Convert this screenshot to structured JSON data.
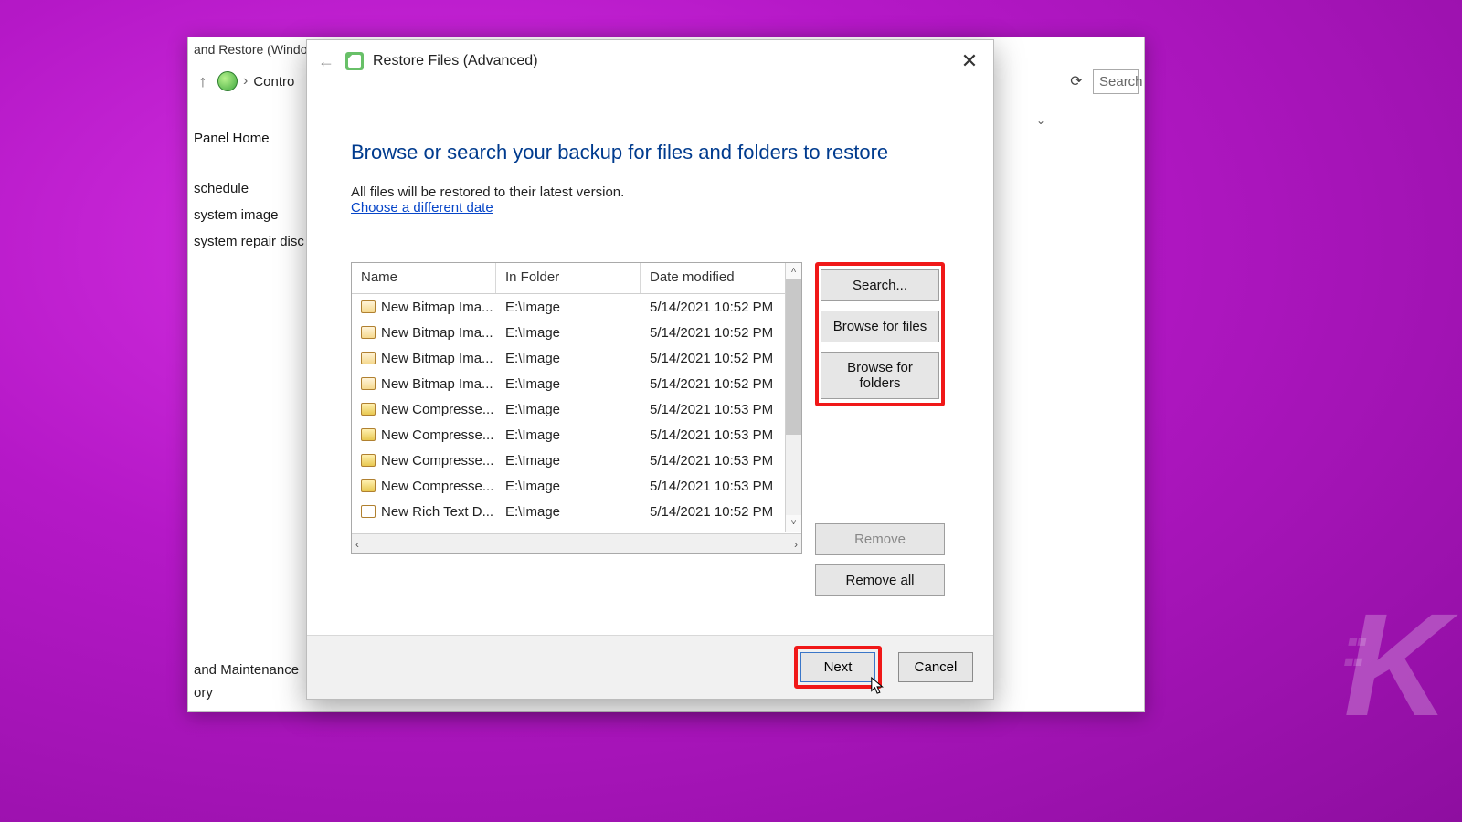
{
  "background_window": {
    "title_fragment": "and Restore (Window...",
    "breadcrumb_start": "Contro",
    "search_placeholder": "Search",
    "sidebar": {
      "home": "Panel Home",
      "items": [
        "schedule",
        "system image",
        "system repair disc"
      ],
      "lower": [
        "and Maintenance",
        "ory"
      ]
    }
  },
  "dialog": {
    "title": "Restore Files (Advanced)",
    "close_symbol": "✕",
    "heading": "Browse or search your backup for files and folders to restore",
    "subtext": "All files will be restored to their latest version.",
    "link_text": "Choose a different date",
    "columns": {
      "name": "Name",
      "folder": "In Folder",
      "date": "Date modified"
    },
    "rows": [
      {
        "icon": "bmp",
        "name": "New Bitmap Ima...",
        "folder": "E:\\Image",
        "date": "5/14/2021 10:52 PM"
      },
      {
        "icon": "bmp",
        "name": "New Bitmap Ima...",
        "folder": "E:\\Image",
        "date": "5/14/2021 10:52 PM"
      },
      {
        "icon": "bmp",
        "name": "New Bitmap Ima...",
        "folder": "E:\\Image",
        "date": "5/14/2021 10:52 PM"
      },
      {
        "icon": "bmp",
        "name": "New Bitmap Ima...",
        "folder": "E:\\Image",
        "date": "5/14/2021 10:52 PM"
      },
      {
        "icon": "zip",
        "name": "New Compresse...",
        "folder": "E:\\Image",
        "date": "5/14/2021 10:53 PM"
      },
      {
        "icon": "zip",
        "name": "New Compresse...",
        "folder": "E:\\Image",
        "date": "5/14/2021 10:53 PM"
      },
      {
        "icon": "zip",
        "name": "New Compresse...",
        "folder": "E:\\Image",
        "date": "5/14/2021 10:53 PM"
      },
      {
        "icon": "zip",
        "name": "New Compresse...",
        "folder": "E:\\Image",
        "date": "5/14/2021 10:53 PM"
      },
      {
        "icon": "doc",
        "name": "New Rich Text D...",
        "folder": "E:\\Image",
        "date": "5/14/2021 10:52 PM"
      }
    ],
    "buttons": {
      "search": "Search...",
      "browse_files": "Browse for files",
      "browse_folders": "Browse for folders",
      "remove": "Remove",
      "remove_all": "Remove all",
      "next": "Next",
      "cancel": "Cancel"
    }
  },
  "watermark": "K"
}
